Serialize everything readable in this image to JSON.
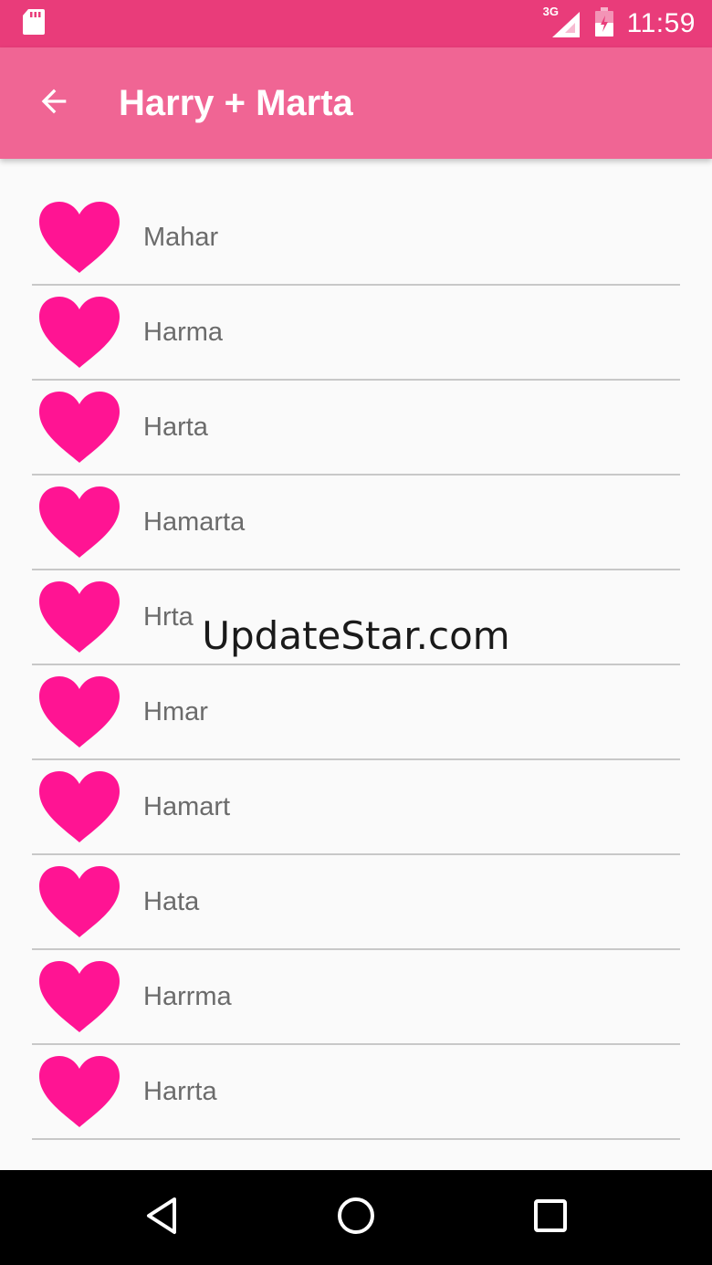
{
  "status_bar": {
    "time": "11:59",
    "network": "3G",
    "icons": [
      "sd-card-icon",
      "signal-icon",
      "battery-icon"
    ]
  },
  "app_bar": {
    "title": "Harry + Marta",
    "back_icon": "back-arrow-icon"
  },
  "colors": {
    "status_bar": "#e93c7a",
    "app_bar": "#f06594",
    "heart": "#ff1493",
    "label_text": "#6b6b6b",
    "divider": "#c8c8c8"
  },
  "list": {
    "items": [
      {
        "label": "Mahar"
      },
      {
        "label": "Harma"
      },
      {
        "label": "Harta"
      },
      {
        "label": "Hamarta"
      },
      {
        "label": "Hrta"
      },
      {
        "label": "Hmar"
      },
      {
        "label": "Hamart"
      },
      {
        "label": "Hata"
      },
      {
        "label": "Harrma"
      },
      {
        "label": "Harrta"
      }
    ]
  },
  "watermark": "UpdateStar.com",
  "nav_bar": {
    "icons": [
      "back-triangle-icon",
      "home-circle-icon",
      "recents-square-icon"
    ]
  }
}
